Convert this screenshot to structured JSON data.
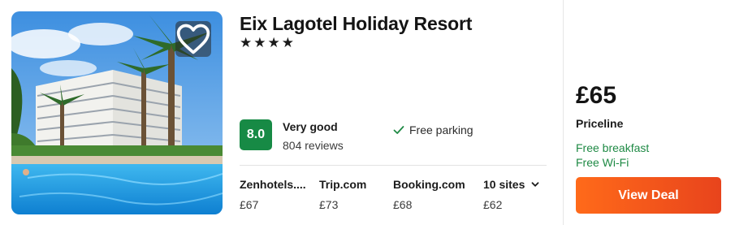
{
  "hotel": {
    "name": "Eix Lagotel Holiday Resort",
    "stars": "★★★★",
    "rating_score": "8.0",
    "rating_label": "Very good",
    "reviews": "804 reviews",
    "amenity": "Free parking",
    "icons": {
      "favorite": "heart-icon",
      "amenity": "check-icon",
      "more": "chevron-down-icon"
    }
  },
  "sites": [
    {
      "name": "Zenhotels....",
      "price": "£67"
    },
    {
      "name": "Trip.com",
      "price": "£73"
    },
    {
      "name": "Booking.com",
      "price": "£68"
    },
    {
      "name": "10 sites",
      "price": "£62"
    }
  ],
  "deal": {
    "price": "£65",
    "provider": "Priceline",
    "perks": [
      "Free breakfast",
      "Free Wi-Fi"
    ],
    "button_label": "View Deal"
  },
  "colors": {
    "rating_badge": "#178a45",
    "perk_text": "#1f8a45",
    "deal_button": "#ff5a1f"
  }
}
